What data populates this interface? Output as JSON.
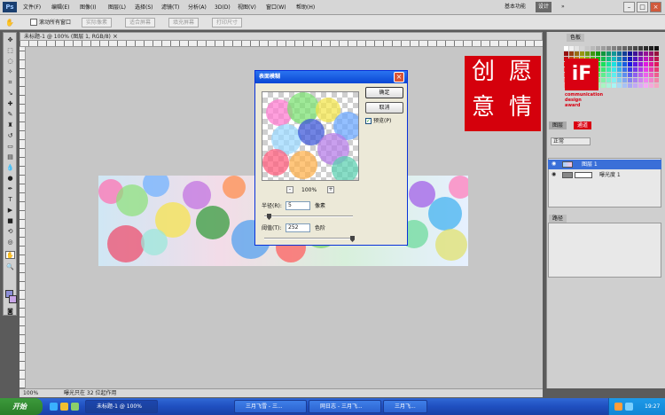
{
  "app": {
    "logo": "Ps",
    "menu": [
      "文件(F)",
      "编辑(E)",
      "图像(I)",
      "图层(L)",
      "选择(S)",
      "滤镜(T)",
      "分析(A)",
      "3D(D)",
      "视图(V)",
      "窗口(W)",
      "帮助(H)"
    ],
    "workspace": {
      "basic": "基本功能",
      "design": "设计",
      "more": "»"
    },
    "window_buttons": {
      "min": "–",
      "max": "□",
      "close": "×"
    }
  },
  "options_bar": {
    "scroll_all": "滚动所有窗口",
    "buttons": [
      "实际像素",
      "适合屏幕",
      "填充屏幕",
      "打印尺寸"
    ]
  },
  "document": {
    "title": "未标题-1 @ 100% (图层 1, RGB/8)",
    "zoom": "100%",
    "status": "曝光只在 32 位起作用"
  },
  "dialog": {
    "title": "表面模糊",
    "ok": "确定",
    "cancel": "取消",
    "preview_label": "预览(P)",
    "preview_checked": true,
    "zoom_level": "100%",
    "zoom_out": "-",
    "zoom_in": "+",
    "radius_label": "半径(R):",
    "radius_value": "5",
    "radius_unit": "像素",
    "threshold_label": "阈值(T):",
    "threshold_value": "252",
    "threshold_unit": "色阶",
    "radius_fraction": 0.05,
    "threshold_fraction": 0.99
  },
  "seal": {
    "chars": [
      "创",
      "意",
      "愿",
      "情"
    ]
  },
  "if_logo": {
    "mark": "iF",
    "lines": [
      "communication",
      "design",
      "award"
    ]
  },
  "panels": {
    "swatches_tab": "色板",
    "layers_tabs": [
      "图层",
      "通道"
    ],
    "blend_mode": "正常",
    "layers": [
      {
        "name": "图层 1",
        "selected": true
      },
      {
        "name": "曝光度 1",
        "selected": false
      }
    ],
    "paths_tab": "路径"
  },
  "taskbar": {
    "start": "开始",
    "tasks": [
      "未标题-1 @ 100%",
      "三月飞雪 - 三...",
      "网日志 - 三月飞...",
      "三月飞..."
    ],
    "clock": "19:27"
  },
  "colors": {
    "accent": "#0a46d4",
    "seal_red": "#d5000c",
    "fg": "#8c8ed6",
    "bg": "#c8a6e6"
  }
}
